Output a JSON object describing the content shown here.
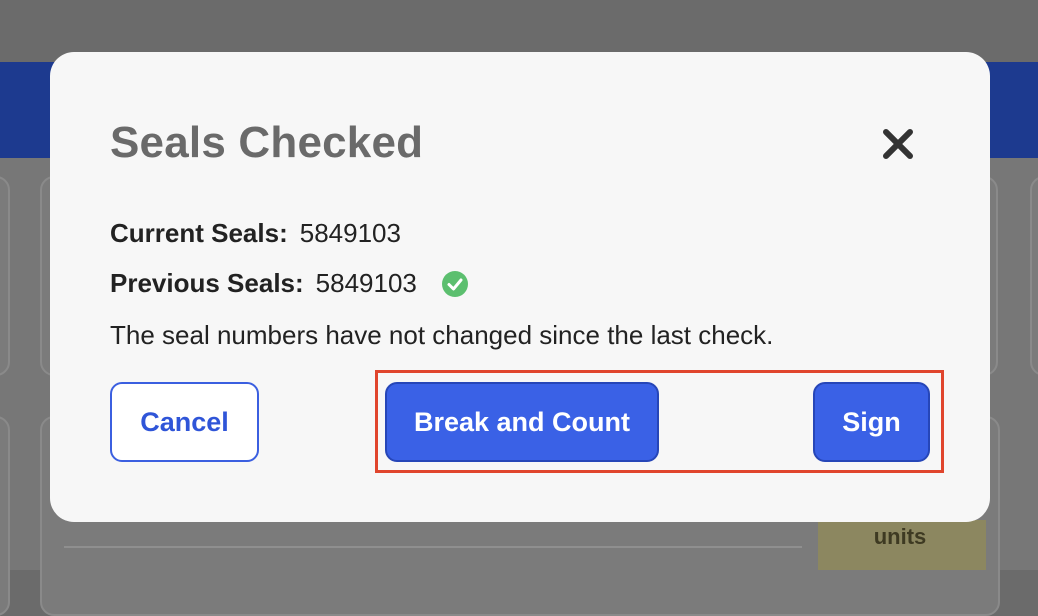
{
  "background": {
    "units_label": "units"
  },
  "modal": {
    "title": "Seals Checked",
    "close_icon": "close-icon",
    "current_seals": {
      "label": "Current Seals:",
      "value": "5849103"
    },
    "previous_seals": {
      "label": "Previous Seals:",
      "value": "5849103",
      "status_icon": "check-circle-icon",
      "status_color": "#5cbf6f"
    },
    "message": "The seal numbers have not changed since the last check.",
    "buttons": {
      "cancel": "Cancel",
      "break_and_count": "Break and Count",
      "sign": "Sign"
    }
  },
  "colors": {
    "primary": "#3a61e6",
    "highlight": "#e0452d",
    "header": "#1d3a8f"
  }
}
